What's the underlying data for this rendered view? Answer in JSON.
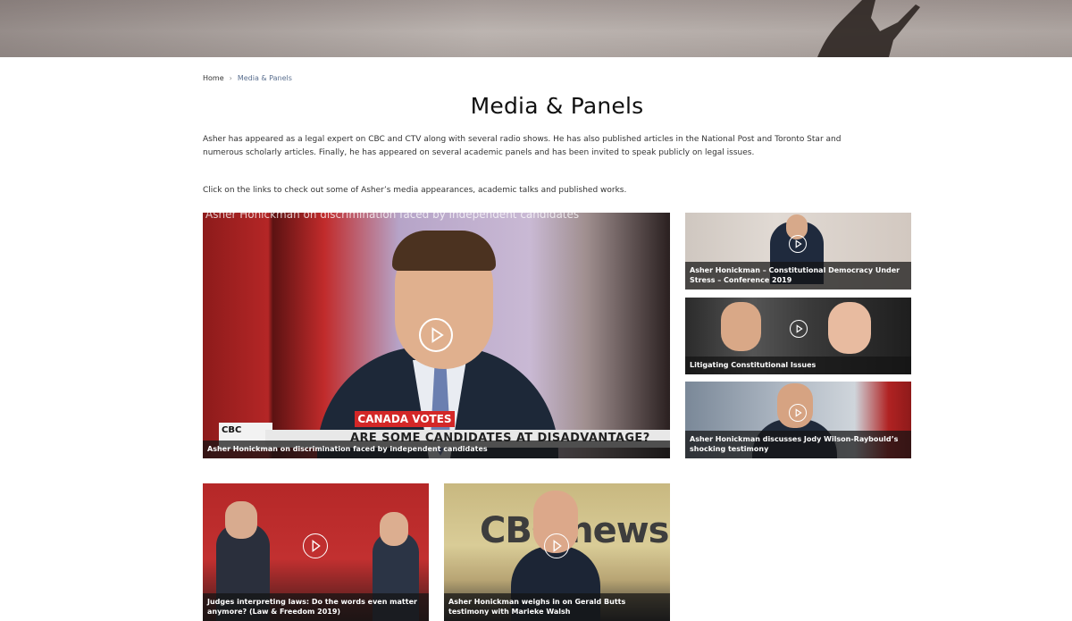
{
  "breadcrumb": {
    "home": "Home",
    "separator": "›",
    "current": "Media & Panels"
  },
  "page": {
    "title": "Media & Panels",
    "intro": "Asher has appeared as a legal expert on CBC and CTV along with several radio shows. He has also published articles in the National Post and Toronto Star and numerous scholarly articles. Finally, he has appeared on several academic panels and has been invited to speak publicly on legal issues.",
    "cta": "Click on the links to check out some of Asher’s media appearances, academic talks and published works."
  },
  "videos": [
    {
      "caption": "Asher Honickman on discrimination faced by independent candidates",
      "overlay_title": "Asher Honickman on discrimination faced by independent candidates",
      "lower_third": "CANADA VOTES",
      "ticker": "ARE SOME CANDIDATES AT DISADVANTAGE?",
      "logo": "CBC"
    },
    {
      "caption": "Asher Honickman – Constitutional Democracy Under Stress – Conference 2019"
    },
    {
      "caption": "Litigating Constitutional Issues"
    },
    {
      "caption": "Asher Honickman discusses Jody Wilson-Raybould’s shocking testimony"
    },
    {
      "caption": "Judges interpreting laws: Do the words even matter anymore? (Law & Freedom 2019)"
    },
    {
      "caption": "Asher Honickman weighs in on Gerald Butts testimony with Marieke Walsh",
      "backdrop": "CBC news"
    }
  ],
  "colors": {
    "accent": "#5a6f8f",
    "caption_bg": "#141414",
    "brand_red": "#d32727"
  },
  "icons": {
    "play": "play-icon"
  }
}
